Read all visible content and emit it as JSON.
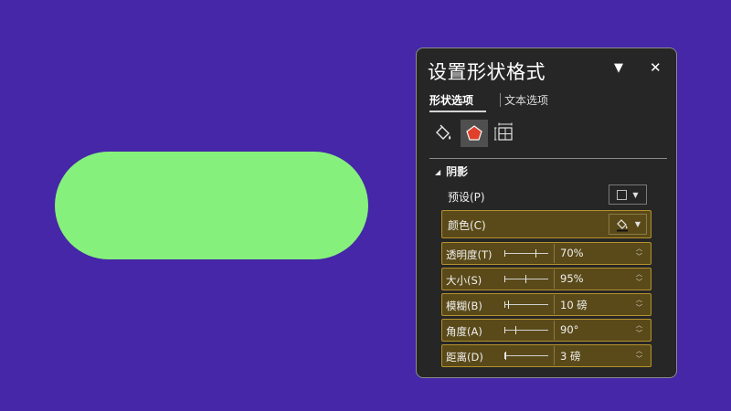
{
  "canvas": {
    "background": "#4527a7",
    "shape_fill": "#86f07c"
  },
  "panel": {
    "title": "设置形状格式",
    "menu_icon": "chevron-down-icon",
    "close_label": "✕",
    "tabs": [
      {
        "label": "形状选项",
        "active": true
      },
      {
        "label": "文本选项",
        "active": false
      }
    ],
    "icon_tabs": [
      {
        "name": "fill-line-icon",
        "selected": false
      },
      {
        "name": "effects-pentagon-icon",
        "selected": true
      },
      {
        "name": "size-properties-icon",
        "selected": false
      }
    ],
    "section": {
      "label": "阴影",
      "expanded": true
    },
    "preset": {
      "label": "预设(P)"
    },
    "color": {
      "label": "颜色(C)"
    },
    "properties": [
      {
        "label": "透明度(T)",
        "value": "70%",
        "level": 0.7
      },
      {
        "label": "大小(S)",
        "value": "95%",
        "level": 0.48
      },
      {
        "label": "模糊(B)",
        "value": "10 磅",
        "level": 0.08
      },
      {
        "label": "角度(A)",
        "value": "90°",
        "level": 0.25
      },
      {
        "label": "距离(D)",
        "value": "3 磅",
        "level": 0.02
      }
    ]
  }
}
